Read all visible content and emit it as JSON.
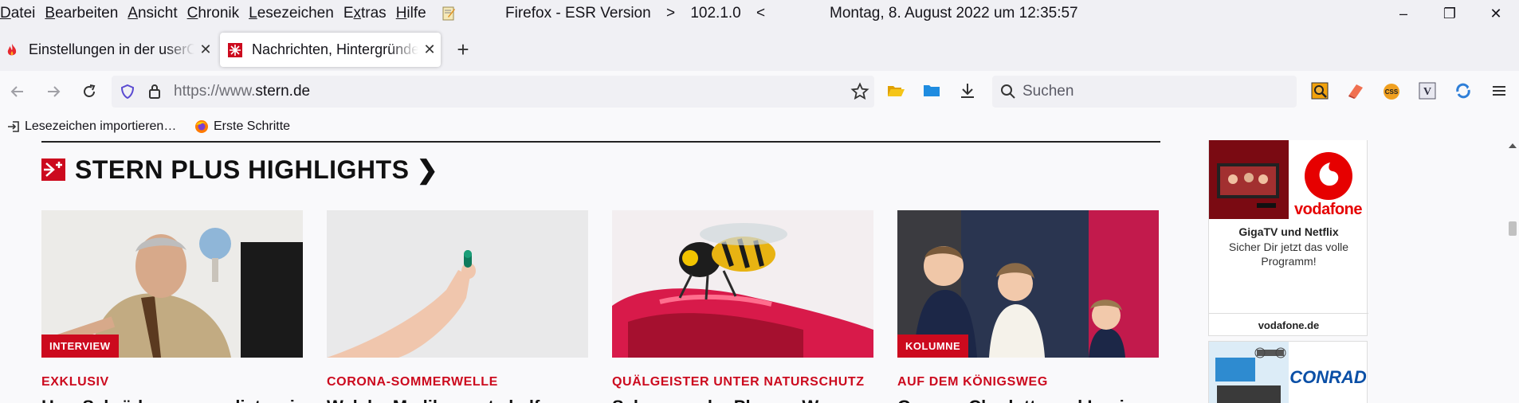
{
  "menubar": {
    "items": [
      {
        "pre": "",
        "ul": "D",
        "post": "atei"
      },
      {
        "pre": "",
        "ul": "B",
        "post": "earbeiten"
      },
      {
        "pre": "",
        "ul": "A",
        "post": "nsicht"
      },
      {
        "pre": "",
        "ul": "C",
        "post": "hronik"
      },
      {
        "pre": "",
        "ul": "L",
        "post": "esezeichen"
      },
      {
        "pre": "E",
        "ul": "x",
        "post": "tras"
      },
      {
        "pre": "",
        "ul": "H",
        "post": "ilfe"
      }
    ],
    "browser_name": "Firefox - ESR Version",
    "separator1": ">",
    "version": "102.1.0",
    "separator2": "<",
    "datetime": "Montag, 8. August 2022 um 12:35:57"
  },
  "window_controls": {
    "minimize": "–",
    "restore": "❐",
    "close": "✕"
  },
  "tabs": [
    {
      "title": "Einstellungen in der userChrome.css",
      "icon": "flame-icon",
      "active": false
    },
    {
      "title": "Nachrichten, Hintergründe und Reportagen",
      "icon": "stern-favicon",
      "active": true
    }
  ],
  "tab_close": "✕",
  "newtab_label": "+",
  "navbar": {
    "url_scheme": "https://www.",
    "url_host": "stern.de",
    "search_placeholder": "Suchen"
  },
  "bookmarks": [
    {
      "label": "Lesezeichen importieren…",
      "icon": "import-icon"
    },
    {
      "label": "Erste Schritte",
      "icon": "firefox-icon"
    }
  ],
  "content": {
    "section_title": "STERN PLUS HIGHLIGHTS ❯",
    "cards": [
      {
        "badge": "INTERVIEW",
        "kicker": "EXKLUSIV",
        "headline": "Herr Schröder, warum distanzieren"
      },
      {
        "badge": "",
        "kicker": "CORONA-SOMMERWELLE",
        "headline": "Welche Medikamente helfen"
      },
      {
        "badge": "",
        "kicker": "QUÄLGEISTER UNTER NATURSCHUTZ",
        "headline": "Schonen oder Plagen: Wespen"
      },
      {
        "badge": "KOLUMNE",
        "kicker": "AUF DEM KÖNIGSWEG",
        "headline": "George, Charlotte und Louis"
      }
    ]
  },
  "ads": {
    "ad1": {
      "brand": "vodafone",
      "headline": "GigaTV und Netflix",
      "body": "Sicher Dir jetzt das volle Programm!",
      "domain": "vodafone.de"
    },
    "ad2": {
      "brand": "CONRAD"
    }
  },
  "colors": {
    "stern_red": "#cc0a1e",
    "vodafone_red": "#e60000",
    "conrad_blue": "#0a4fa6"
  }
}
